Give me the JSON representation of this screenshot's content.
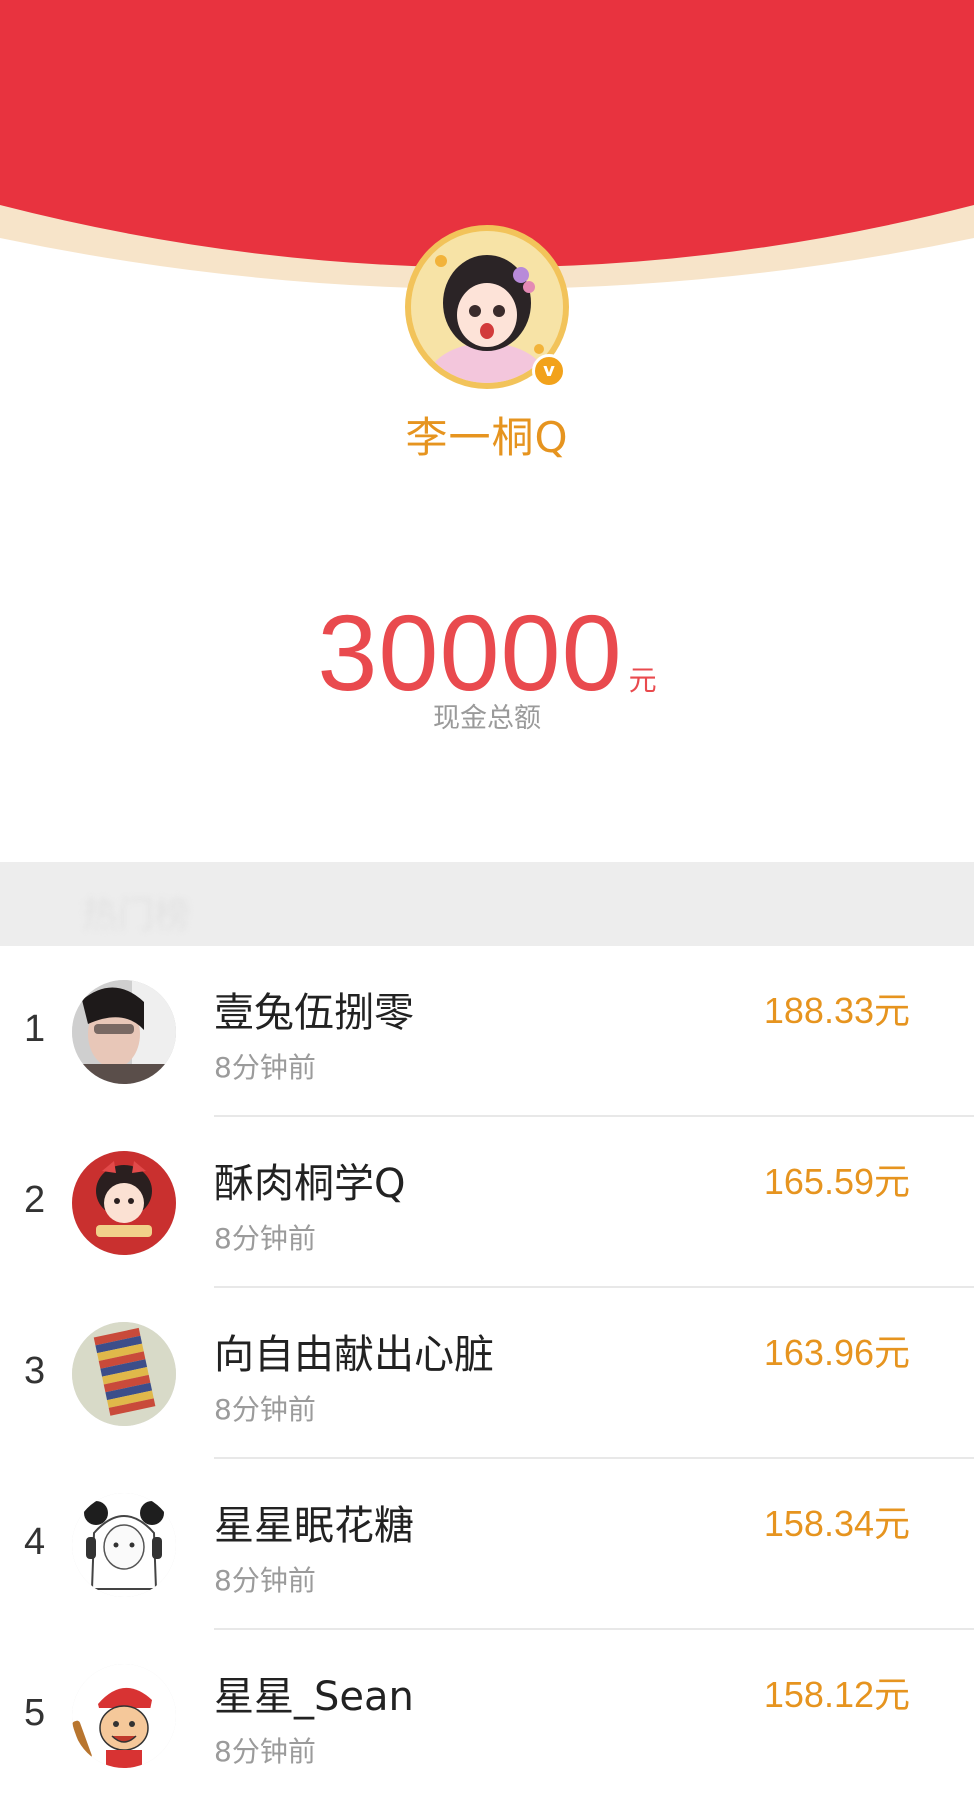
{
  "colors": {
    "red_envelope": "#e8333f",
    "accent_gold": "#e6941f",
    "amount_red": "#e94a4e",
    "section_gray": "#ededed"
  },
  "sender": {
    "name": "李一桐Q",
    "verified_icon": "v"
  },
  "total": {
    "amount": "30000",
    "unit": "元",
    "caption": "现金总额"
  },
  "section": {
    "title": "热门榜"
  },
  "ranking": [
    {
      "rank": "1",
      "name": "壹兔伍捌零",
      "time": "8分钟前",
      "amount": "188.33元",
      "avatar": "photo-avatar"
    },
    {
      "rank": "2",
      "name": "酥肉桐学Q",
      "time": "8分钟前",
      "amount": "165.59元",
      "avatar": "cartoon-girl-avatar"
    },
    {
      "rank": "3",
      "name": "向自由献出心脏",
      "time": "8分钟前",
      "amount": "163.96元",
      "avatar": "striped-cloth-avatar"
    },
    {
      "rank": "4",
      "name": "星星眠花糖",
      "time": "8分钟前",
      "amount": "158.34元",
      "avatar": "sketch-girl-avatar"
    },
    {
      "rank": "5",
      "name": "星星_Sean",
      "time": "8分钟前",
      "amount": "158.12元",
      "avatar": "cartoon-boy-avatar"
    }
  ]
}
